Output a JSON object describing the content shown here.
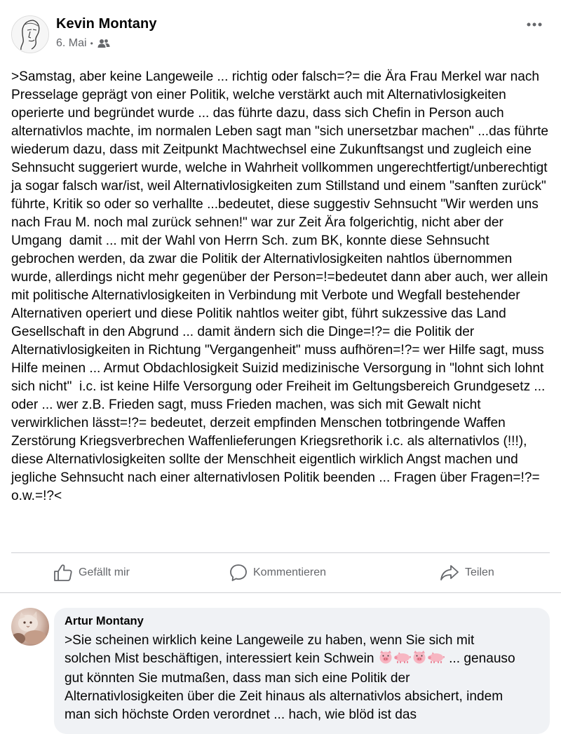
{
  "post": {
    "author": "Kevin Montany",
    "date": "6. Mai",
    "separator": "•",
    "audience_icon": "friends-icon",
    "more_icon": "more-options-icon",
    "text": ">Samstag, aber keine Langeweile ... richtig oder falsch=?= die Ära Frau Merkel war nach Presselage geprägt von einer Politik, welche verstärkt auch mit Alternativlosigkeiten operierte und begründet wurde ... das führte dazu, dass sich Chefin in Person auch alternativlos machte, im normalen Leben sagt man \"sich unersetzbar machen\" ...das führte wiederum dazu, dass mit Zeitpunkt Machtwechsel eine Zukunftsangst und zugleich eine Sehnsucht suggeriert wurde, welche in Wahrheit vollkommen ungerechtfertigt/unberechtigt ja sogar falsch war/ist, weil Alternativlosigkeiten zum Stillstand und einem \"sanften zurück\" führte, Kritik so oder so verhallte ...bedeutet, diese suggestiv Sehnsucht \"Wir werden uns nach Frau M. noch mal zurück sehnen!\" war zur Zeit Ära folgerichtig, nicht aber der Umgang  damit ... mit der Wahl von Herrn Sch. zum BK, konnte diese Sehnsucht gebrochen werden, da zwar die Politik der Alternativlosigkeiten nahtlos übernommen wurde, allerdings nicht mehr gegenüber der Person=!=bedeutet dann aber auch, wer allein mit politische Alternativlosigkeiten in Verbindung mit Verbote und Wegfall bestehender Alternativen operiert und diese Politik nahtlos weiter gibt, führt sukzessive das Land Gesellschaft in den Abgrund ... damit ändern sich die Dinge=!?= die Politik der Alternativlosigkeiten in Richtung \"Vergangenheit\" muss aufhören=!?= wer Hilfe sagt, muss Hilfe meinen ... Armut Obdachlosigkeit Suizid medizinische Versorgung in \"lohnt sich lohnt sich nicht\"  i.c. ist keine Hilfe Versorgung oder Freiheit im Geltungsbereich Grundgesetz ... oder ... wer z.B. Frieden sagt, muss Frieden machen, was sich mit Gewalt nicht verwirklichen lässt=!?= bedeutet, derzeit empfinden Menschen totbringende Waffen Zerstörung Kriegsverbrechen Waffenlieferungen Kriegsrethorik i.c. als alternativlos (!!!),  diese Alternativlosigkeiten sollte der Menschheit eigentlich wirklich Angst machen und jegliche Sehnsucht nach einer alternativlosen Politik beenden ... Fragen über Fragen=!?= o.w.=!?<"
  },
  "actions": {
    "like": "Gefällt mir",
    "comment": "Kommentieren",
    "share": "Teilen"
  },
  "comment": {
    "author": "Artur Montany",
    "text_before_emoji": ">Sie scheinen wirklich keine Langeweile zu haben, wenn Sie sich mit solchen Mist beschäftigen, interessiert kein Schwein ",
    "emoji": [
      "pig-face-icon",
      "pig-icon",
      "pig-face-icon",
      "pig-icon"
    ],
    "text_after_emoji": " ... genauso gut könnten Sie mutmaßen, dass man sich eine Politik der Alternativlosigkeiten über die Zeit hinaus als alternativlos absichert, indem man sich höchste Orden verordnet ... hach, wie blöd ist das"
  },
  "colors": {
    "text": "#050505",
    "secondary": "#65676b",
    "divider": "#ced0d4",
    "bubble": "#f0f2f5"
  }
}
